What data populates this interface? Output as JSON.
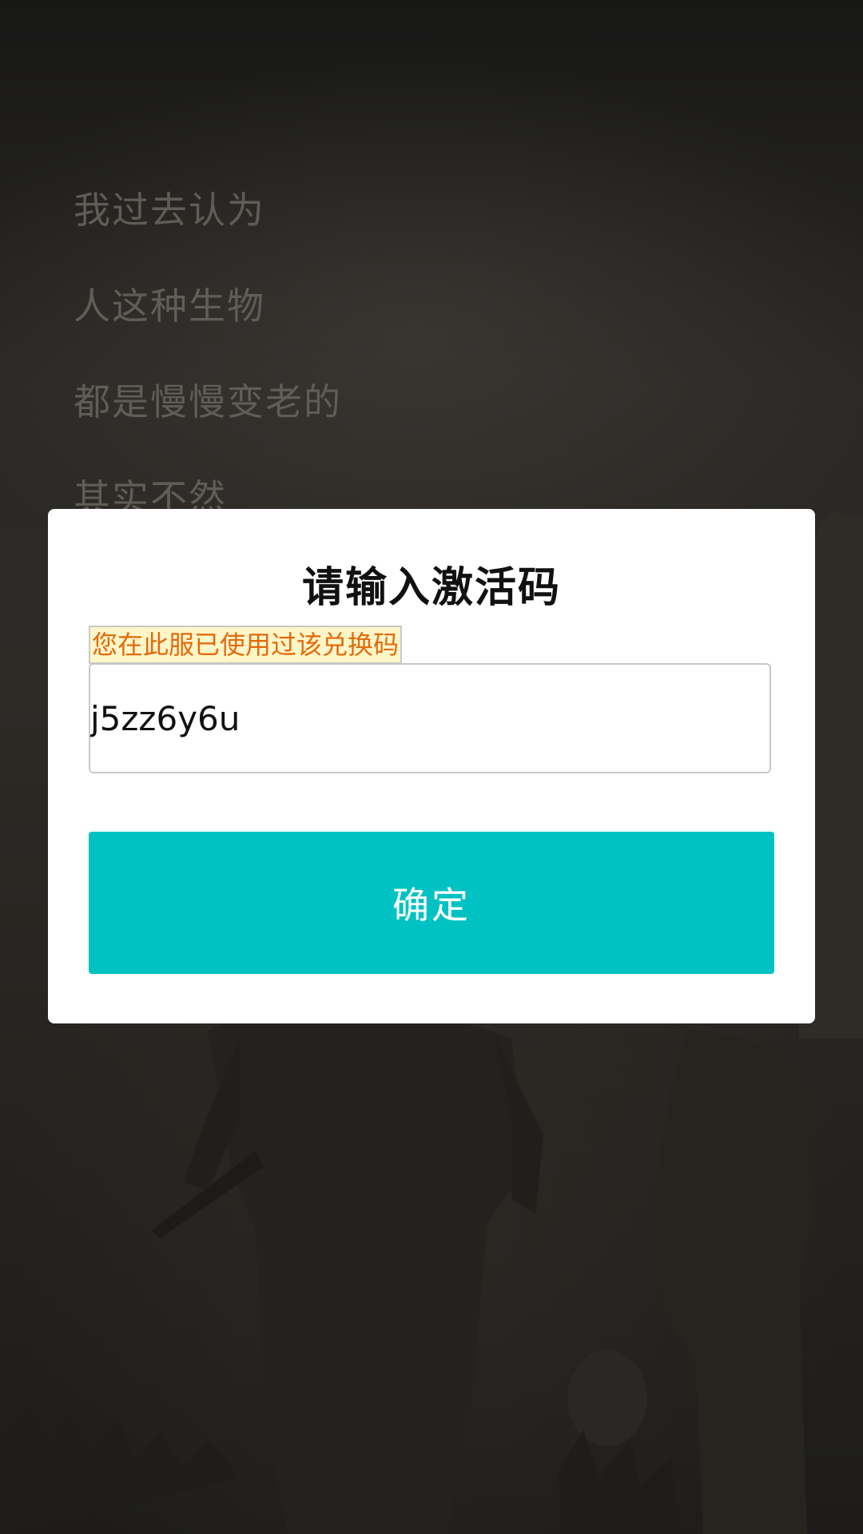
{
  "background": {
    "story_lines": [
      "我过去认为",
      "人这种生物",
      "都是慢慢变老的",
      "其实不然"
    ]
  },
  "dialog": {
    "title": "请输入激活码",
    "error_message": "您在此服已使用过该兑换码",
    "code_input": {
      "value": "j5zz6y6u",
      "placeholder": ""
    },
    "confirm_label": "确定"
  },
  "colors": {
    "accent": "#00c2c2",
    "error_text": "#e36a0c",
    "error_bg": "#fdf6c9"
  }
}
